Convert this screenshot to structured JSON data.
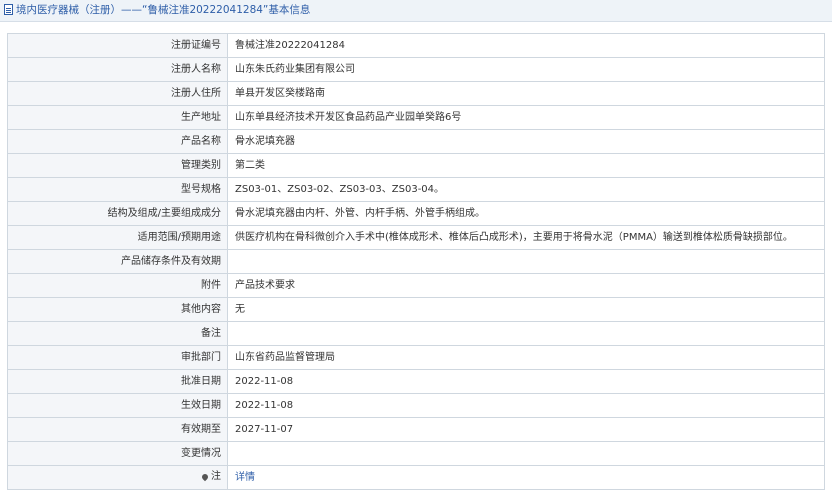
{
  "header": {
    "title": "境内医疗器械（注册）——“鲁械注准20222041284”基本信息"
  },
  "rows": [
    {
      "label": "注册证编号",
      "value": "鲁械注准20222041284"
    },
    {
      "label": "注册人名称",
      "value": "山东朱氏药业集团有限公司"
    },
    {
      "label": "注册人住所",
      "value": "单县开发区癸楼路南"
    },
    {
      "label": "生产地址",
      "value": "山东单县经济技术开发区食品药品产业园单癸路6号"
    },
    {
      "label": "产品名称",
      "value": "骨水泥填充器"
    },
    {
      "label": "管理类别",
      "value": "第二类"
    },
    {
      "label": "型号规格",
      "value": "ZS03-01、ZS03-02、ZS03-03、ZS03-04。"
    },
    {
      "label": "结构及组成/主要组成成分",
      "value": "骨水泥填充器由内杆、外管、内杆手柄、外管手柄组成。"
    },
    {
      "label": "适用范围/预期用途",
      "value": "供医疗机构在骨科微创介入手术中(椎体成形术、椎体后凸成形术)，主要用于将骨水泥（PMMA）输送到椎体松质骨缺损部位。"
    },
    {
      "label": "产品储存条件及有效期",
      "value": ""
    },
    {
      "label": "附件",
      "value": "产品技术要求"
    },
    {
      "label": "其他内容",
      "value": "无"
    },
    {
      "label": "备注",
      "value": ""
    },
    {
      "label": "审批部门",
      "value": "山东省药品监督管理局"
    },
    {
      "label": "批准日期",
      "value": "2022-11-08"
    },
    {
      "label": "生效日期",
      "value": "2022-11-08"
    },
    {
      "label": "有效期至",
      "value": "2027-11-07"
    },
    {
      "label": "变更情况",
      "value": ""
    }
  ],
  "note_row": {
    "label": "注",
    "icon": "pin-icon",
    "link_text": "详情"
  },
  "colors": {
    "accent": "#2e5ea8",
    "label_bg": "#f4f6f9",
    "border": "#cfd7df"
  }
}
